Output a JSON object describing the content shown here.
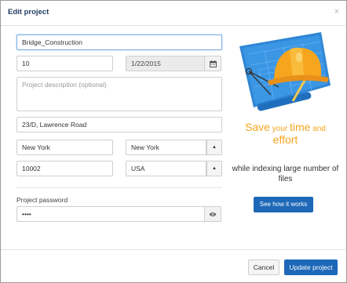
{
  "dialog": {
    "title": "Edit project",
    "close_icon": "×"
  },
  "form": {
    "project_name": "Bridge_Construction",
    "number": "10",
    "date": "1/22/2015",
    "calendar_icon": "calendar-icon",
    "description_placeholder": "Project description (optional)",
    "address": "23/D, Lawrence Road",
    "city": "New York",
    "state": "New York",
    "zip": "10002",
    "country": "USA",
    "password_label": "Project password",
    "password_value": "••••",
    "eye_icon": "eye-icon"
  },
  "promo": {
    "w1": "Save",
    "w2": " your ",
    "w3": "time",
    "w4": " and",
    "w5": "effort",
    "subtitle": "while indexing large number of files",
    "cta": "See how it works"
  },
  "footer": {
    "cancel": "Cancel",
    "update": "Update project"
  },
  "colors": {
    "accent": "#1d68b8",
    "promo": "#f5a51d"
  }
}
